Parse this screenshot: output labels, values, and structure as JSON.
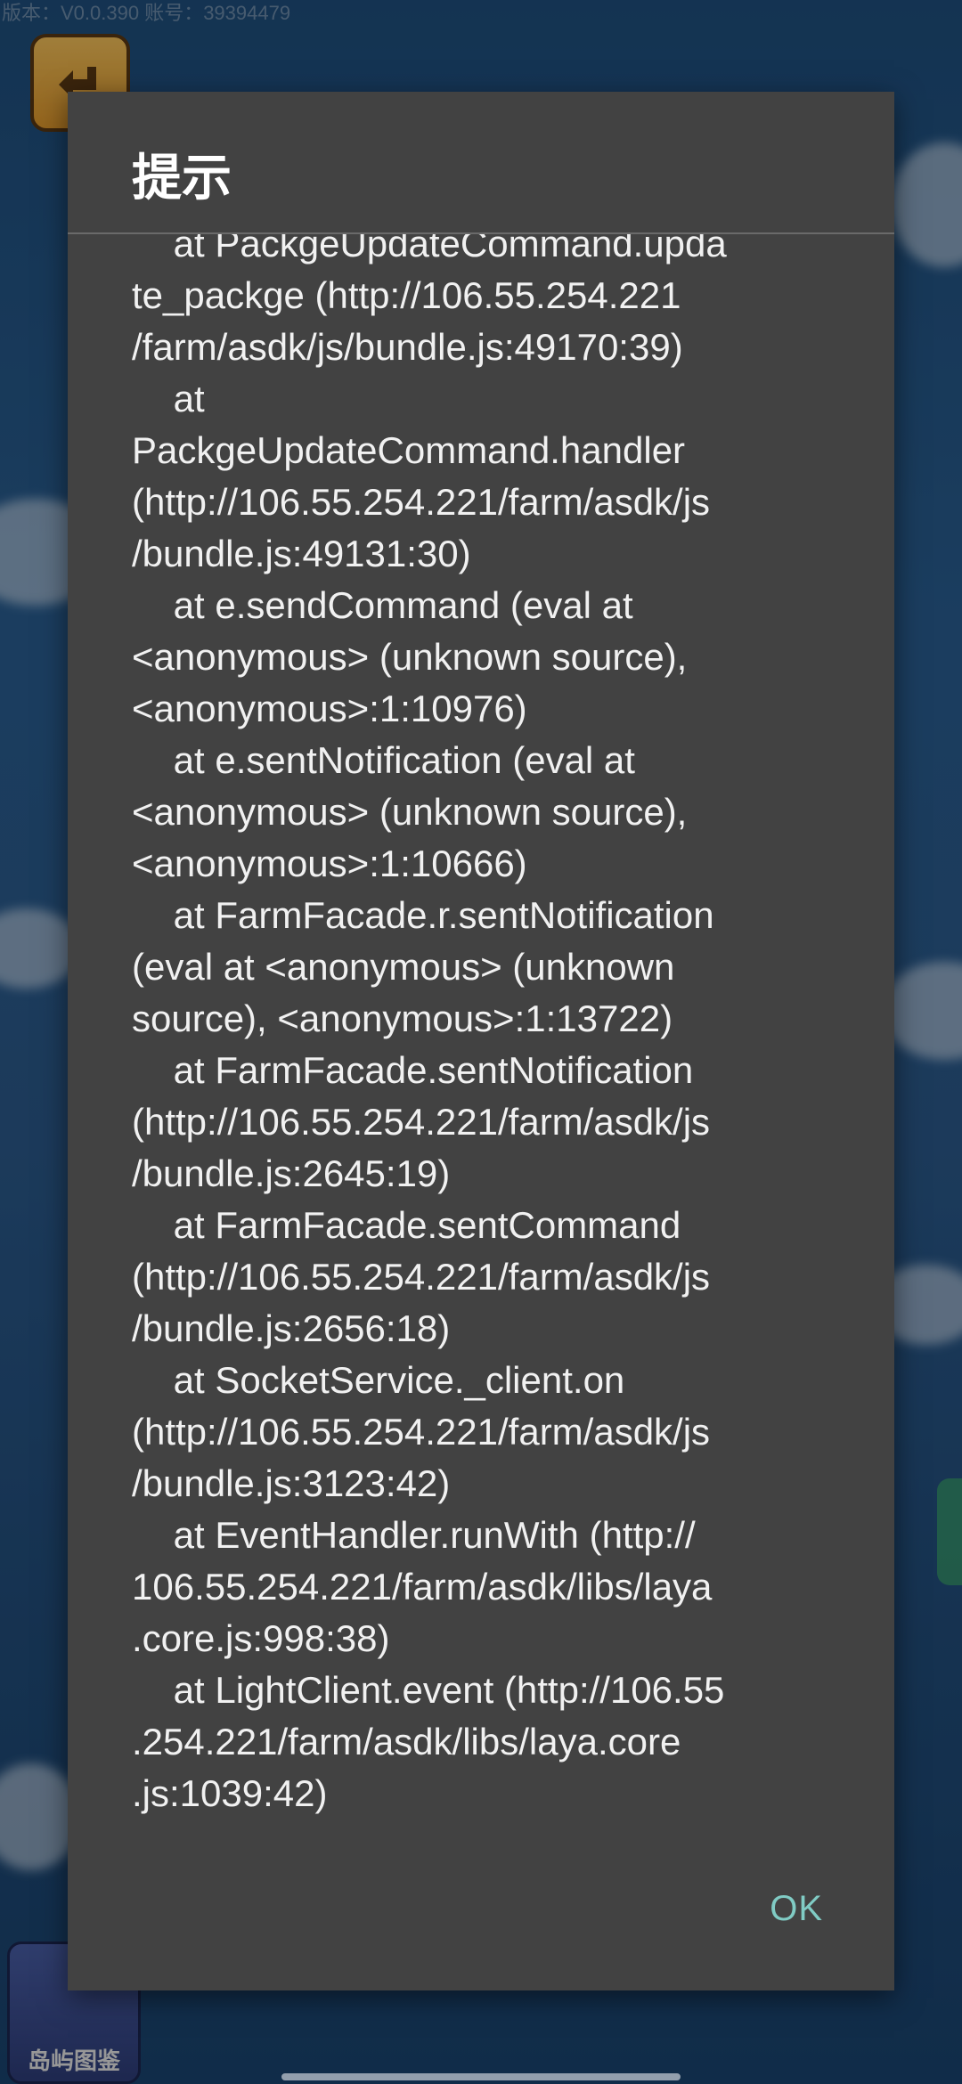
{
  "topbar": {
    "version_text": "版本：V0.0.390   账号：39394479"
  },
  "background": {
    "bottom_icon_label": "岛屿图鉴"
  },
  "dialog": {
    "title": "提示",
    "stack_lines": [
      "    at PackgeUpdateCommand.upda",
      "te_packge (http://106.55.254.221",
      "/farm/asdk/js/bundle.js:49170:39)",
      "    at",
      "PackgeUpdateCommand.handler",
      "(http://106.55.254.221/farm/asdk/js",
      "/bundle.js:49131:30)",
      "    at e.sendCommand (eval at",
      "<anonymous> (unknown source),",
      "<anonymous>:1:10976)",
      "    at e.sentNotification (eval at",
      "<anonymous> (unknown source),",
      "<anonymous>:1:10666)",
      "    at FarmFacade.r.sentNotification",
      "(eval at <anonymous> (unknown",
      "source), <anonymous>:1:13722)",
      "    at FarmFacade.sentNotification",
      "(http://106.55.254.221/farm/asdk/js",
      "/bundle.js:2645:19)",
      "    at FarmFacade.sentCommand",
      "(http://106.55.254.221/farm/asdk/js",
      "/bundle.js:2656:18)",
      "    at SocketService._client.on",
      "(http://106.55.254.221/farm/asdk/js",
      "/bundle.js:3123:42)",
      "    at EventHandler.runWith (http://",
      "106.55.254.221/farm/asdk/libs/laya",
      ".core.js:998:38)",
      "    at LightClient.event (http://106.55",
      ".254.221/farm/asdk/libs/laya.core",
      ".js:1039:42)"
    ],
    "ok_label": "OK"
  },
  "colors": {
    "dialog_bg": "#424242",
    "accent": "#80cbc4",
    "text": "#f1f1f1"
  }
}
